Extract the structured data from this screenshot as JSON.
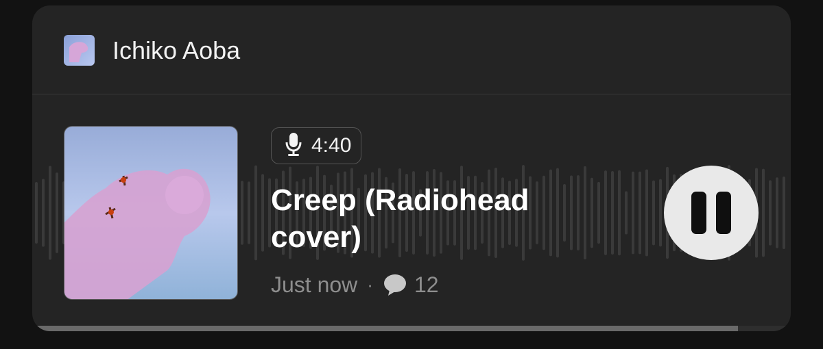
{
  "post": {
    "artist": "Ichiko Aoba",
    "duration": "4:40",
    "title": "Creep (Radiohead cover)",
    "timestamp": "Just now",
    "separator": "·",
    "comment_count": "12",
    "progress": 0.93
  },
  "icons": {
    "avatar": "album-art-thumbnail",
    "badge": "microphone-icon",
    "comment": "speech-bubble-icon",
    "control": "pause-icon"
  },
  "colors": {
    "card_bg": "#242424",
    "page_bg": "#121212",
    "button_bg": "#e9e9e9",
    "progress_fill": "#6a6a6a"
  }
}
